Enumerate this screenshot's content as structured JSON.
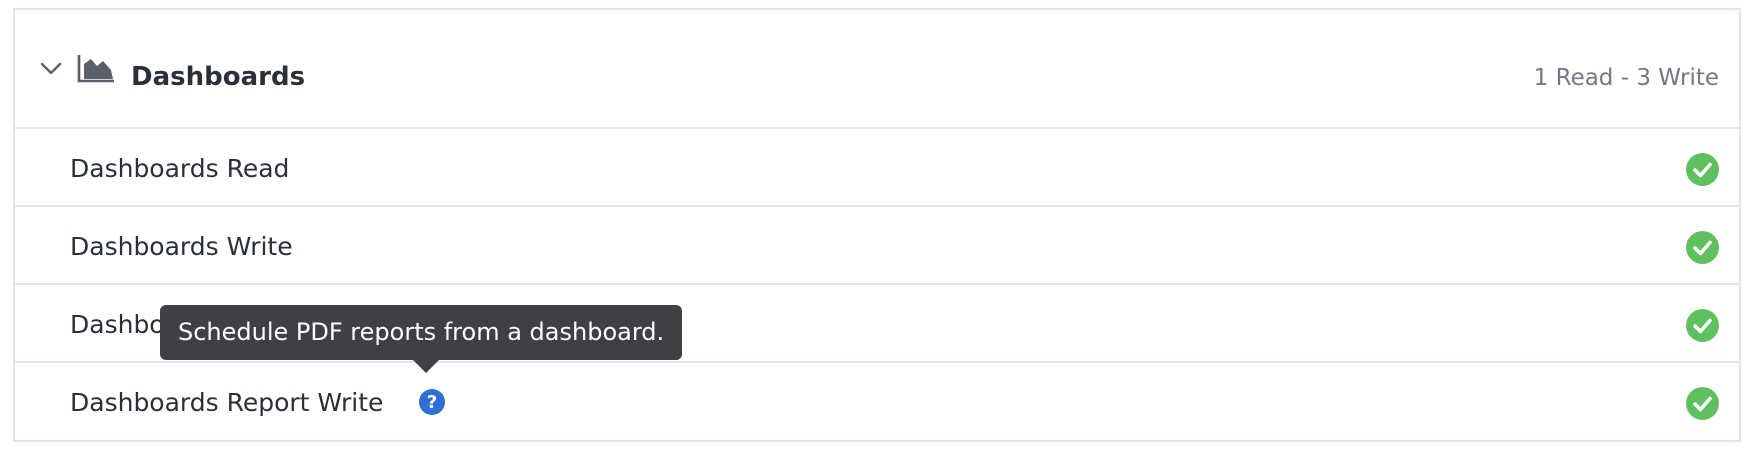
{
  "section": {
    "title": "Dashboards",
    "summary": "1 Read - 3 Write",
    "expand_icon": "chevron-down-icon",
    "section_icon": "area-chart-icon"
  },
  "permissions": [
    {
      "label": "Dashboards Read",
      "status": "enabled",
      "icon": "check-circle-icon"
    },
    {
      "label": "Dashboards Write",
      "status": "enabled",
      "icon": "check-circle-icon"
    },
    {
      "label": "Dashboards Public Share",
      "status": "enabled",
      "icon": "check-circle-icon"
    },
    {
      "label": "Dashboards Report Write",
      "status": "enabled",
      "icon": "check-circle-icon",
      "help_icon": "question-circle-icon"
    }
  ],
  "tooltip": {
    "text": "Schedule PDF reports from a dashboard."
  },
  "colors": {
    "check_green": "#5fc060",
    "help_blue": "#2f6ed2",
    "border": "#e2e4ee",
    "tooltip_bg": "#3f3f45"
  }
}
